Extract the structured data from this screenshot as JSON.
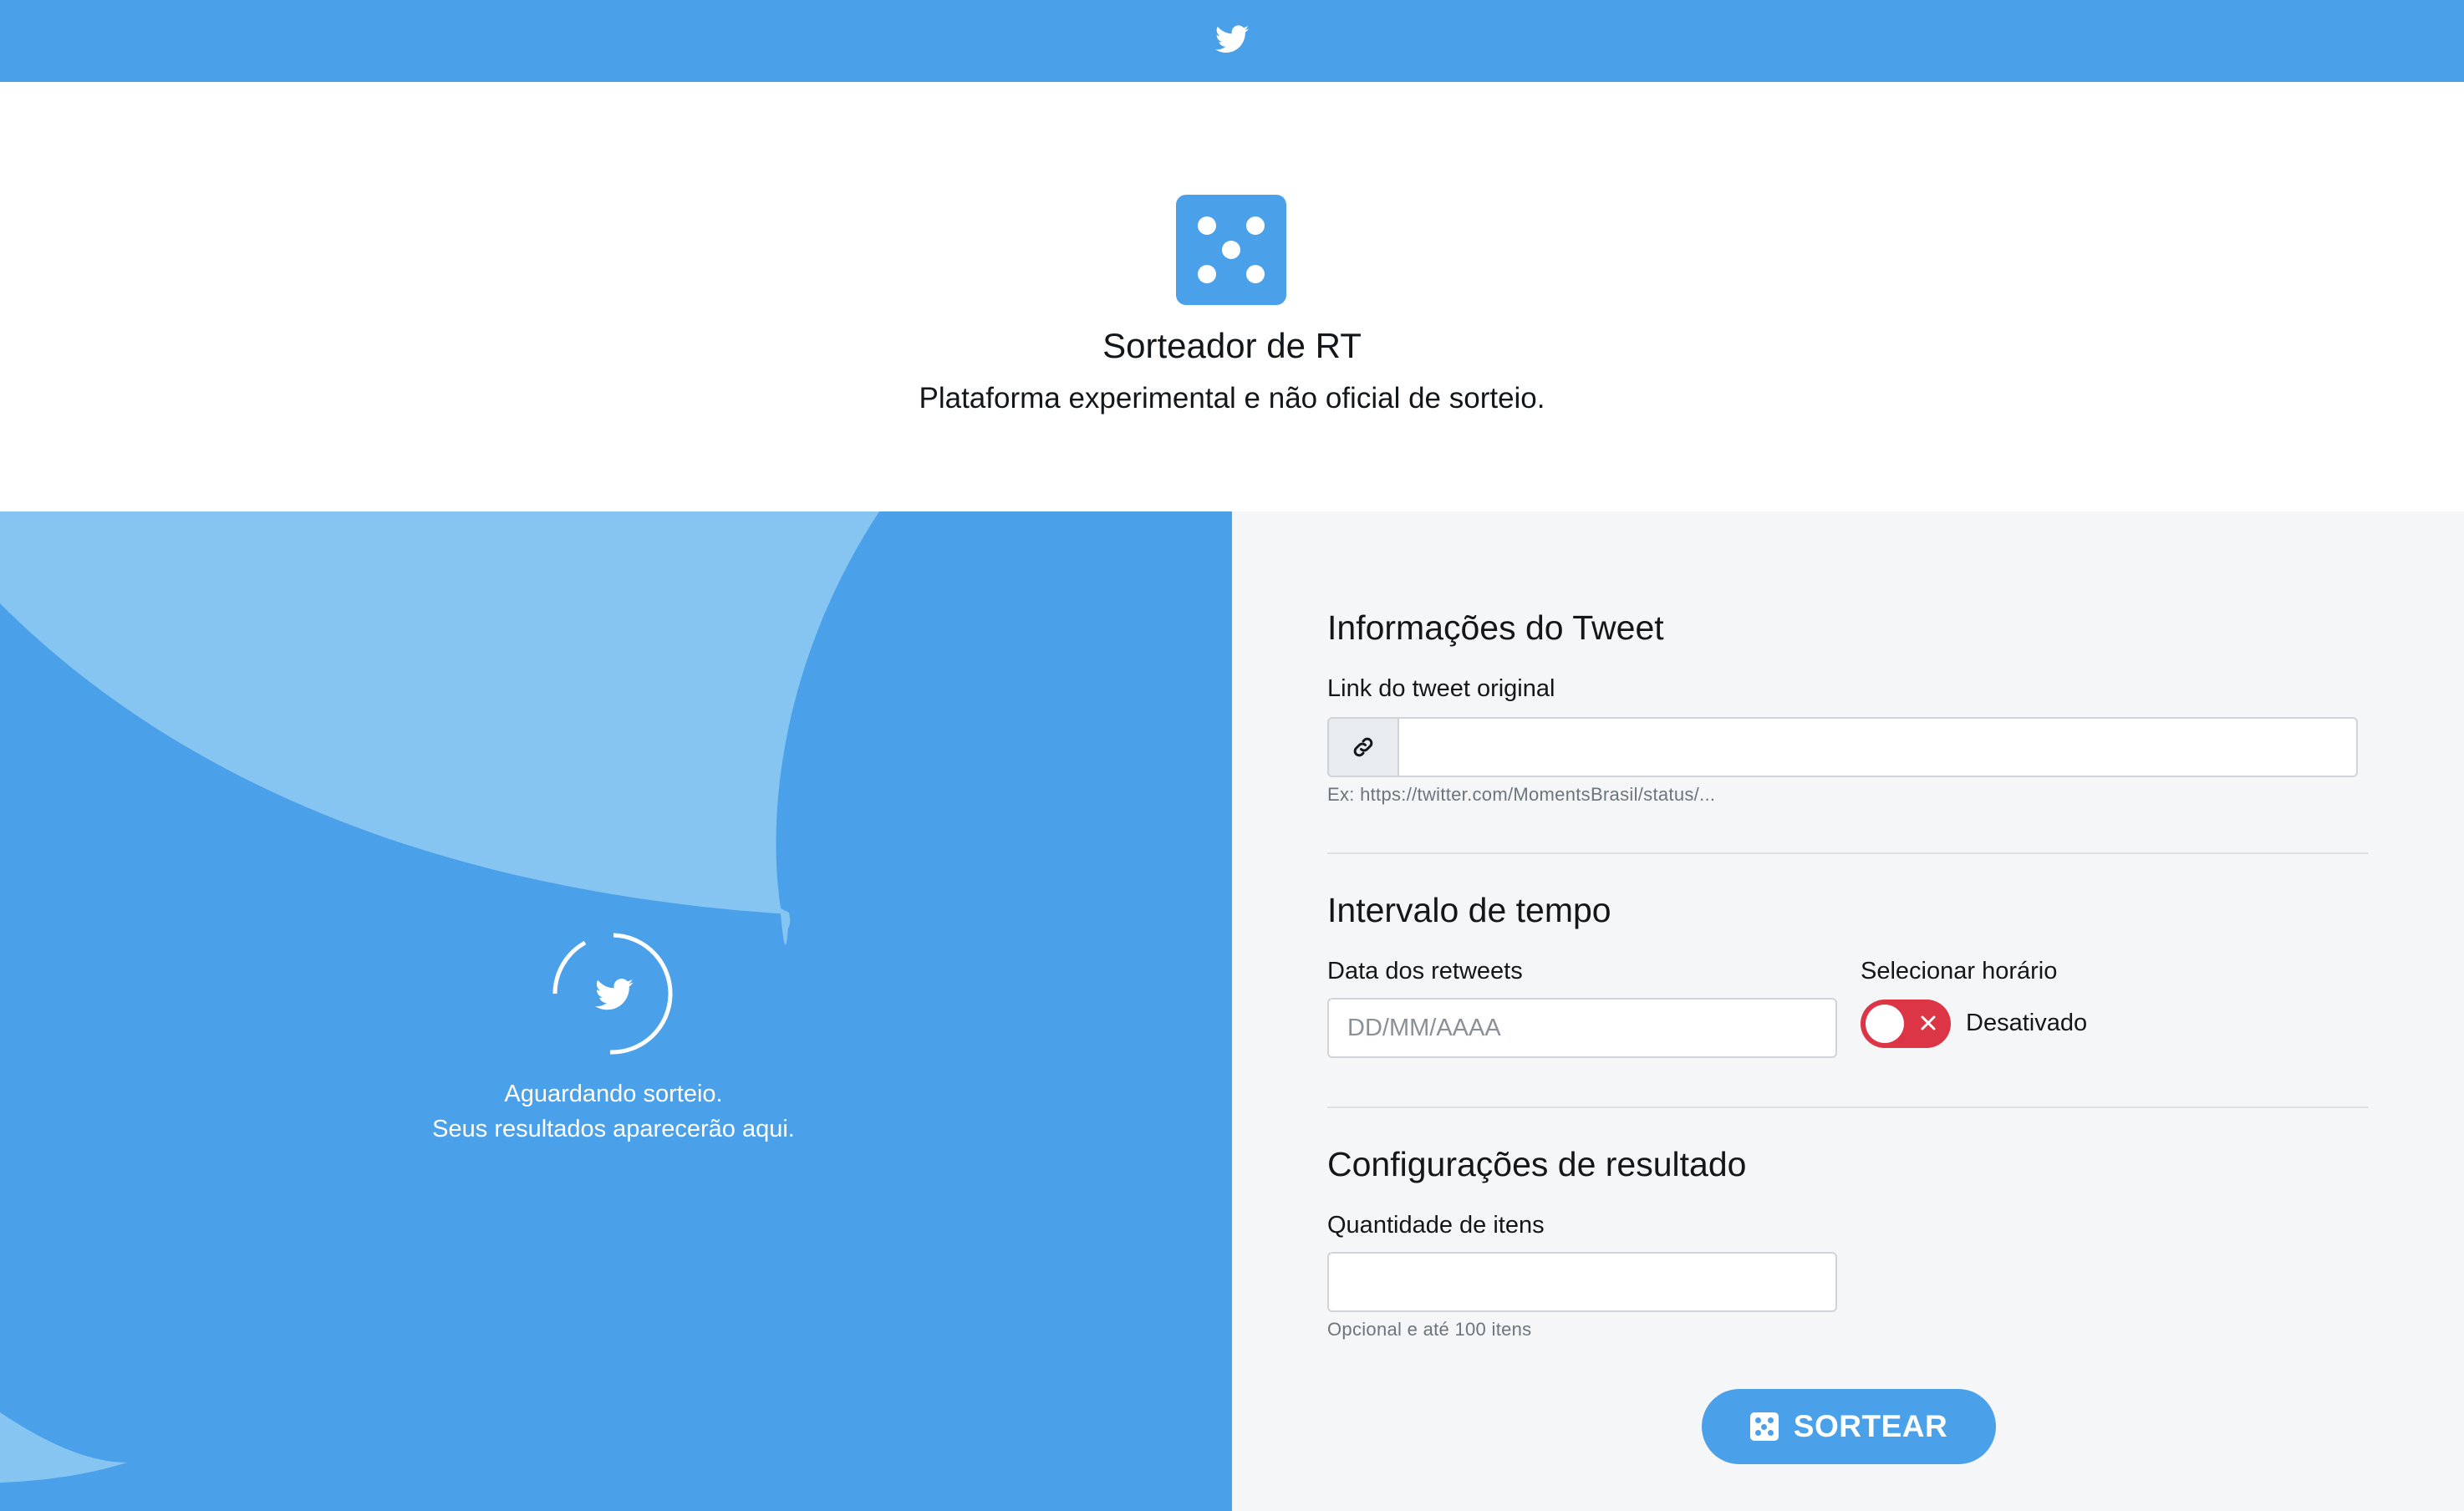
{
  "header": {
    "logo_icon": "twitter-bird-icon"
  },
  "hero": {
    "icon": "dice-five-icon",
    "title": "Sorteador de RT",
    "subtitle": "Plataforma experimental e não oficial de sorteio."
  },
  "status": {
    "line1": "Aguardando sorteio.",
    "line2": "Seus resultados aparecerão aqui."
  },
  "tweet_section": {
    "title": "Informações do Tweet",
    "link_label": "Link do tweet original",
    "link_value": "",
    "link_icon": "link-icon",
    "link_hint": "Ex: https://twitter.com/MomentsBrasil/status/..."
  },
  "time_section": {
    "title": "Intervalo de tempo",
    "date_label": "Data dos retweets",
    "date_placeholder": "DD/MM/AAAA",
    "time_label": "Selecionar horário",
    "toggle_state": "Desativado"
  },
  "result_section": {
    "title": "Configurações de resultado",
    "qty_label": "Quantidade de itens",
    "qty_value": "",
    "qty_hint": "Opcional e até 100 itens"
  },
  "action": {
    "label": "SORTEAR",
    "icon": "dice-five-icon"
  },
  "colors": {
    "brand": "#4aa1ea",
    "brand_light": "#86c5f2",
    "danger": "#dc3545",
    "panel_bg": "#f5f6f8"
  }
}
